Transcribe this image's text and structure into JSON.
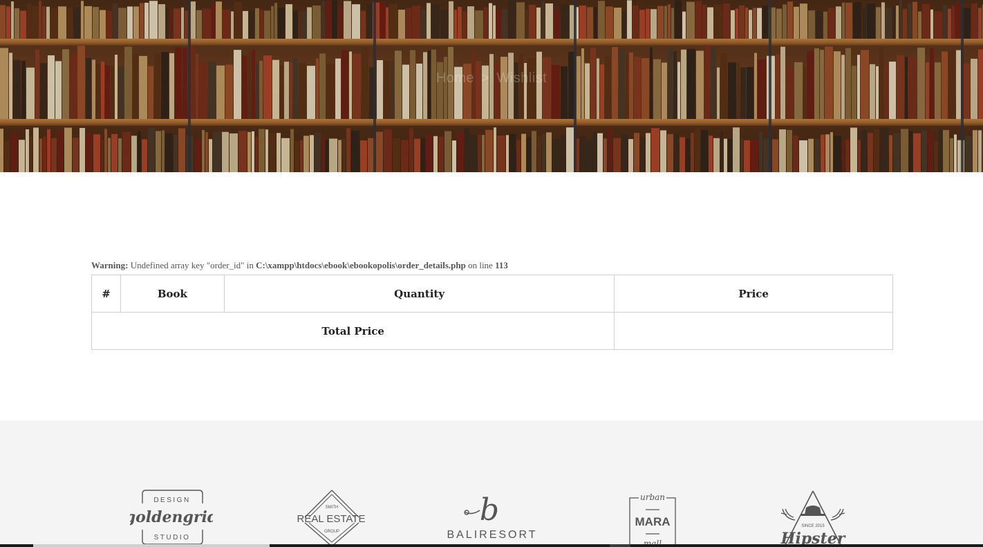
{
  "hero": {
    "breadcrumb": {
      "home": "Home",
      "separator": ">",
      "current": "Wishlist"
    }
  },
  "warning": {
    "label": "Warning",
    "message": "Undefined array key \"order_id\" in",
    "file": "C:\\xampp\\htdocs\\ebook\\ebookopolis\\order_details.php",
    "line_text": "on line",
    "line": "113"
  },
  "table": {
    "headers": [
      "#",
      "Book",
      "Quantity",
      "Price"
    ],
    "total_label": "Total Price",
    "total_value": ""
  },
  "partners": {
    "logos": [
      {
        "name": "goldengrid",
        "top": "DESIGN",
        "script": "goldengrid",
        "bottom": "STUDIO"
      },
      {
        "name": "real-estate",
        "top": "SMITH",
        "main": "REAL ESTATE",
        "bottom": "GROUP"
      },
      {
        "name": "baliresort",
        "mark": "b",
        "main": "BALIRESORT"
      },
      {
        "name": "mara",
        "top": "urban",
        "main": "MARA",
        "bottom": "mall"
      },
      {
        "name": "hipster",
        "small": "SINCE 2015",
        "main": "Hipster"
      }
    ]
  },
  "colors": {
    "banner": "#5a3420",
    "plank": "#b8763c",
    "text": "#222222",
    "muted": "#555555",
    "footer_bg": "#f4f4f4"
  }
}
